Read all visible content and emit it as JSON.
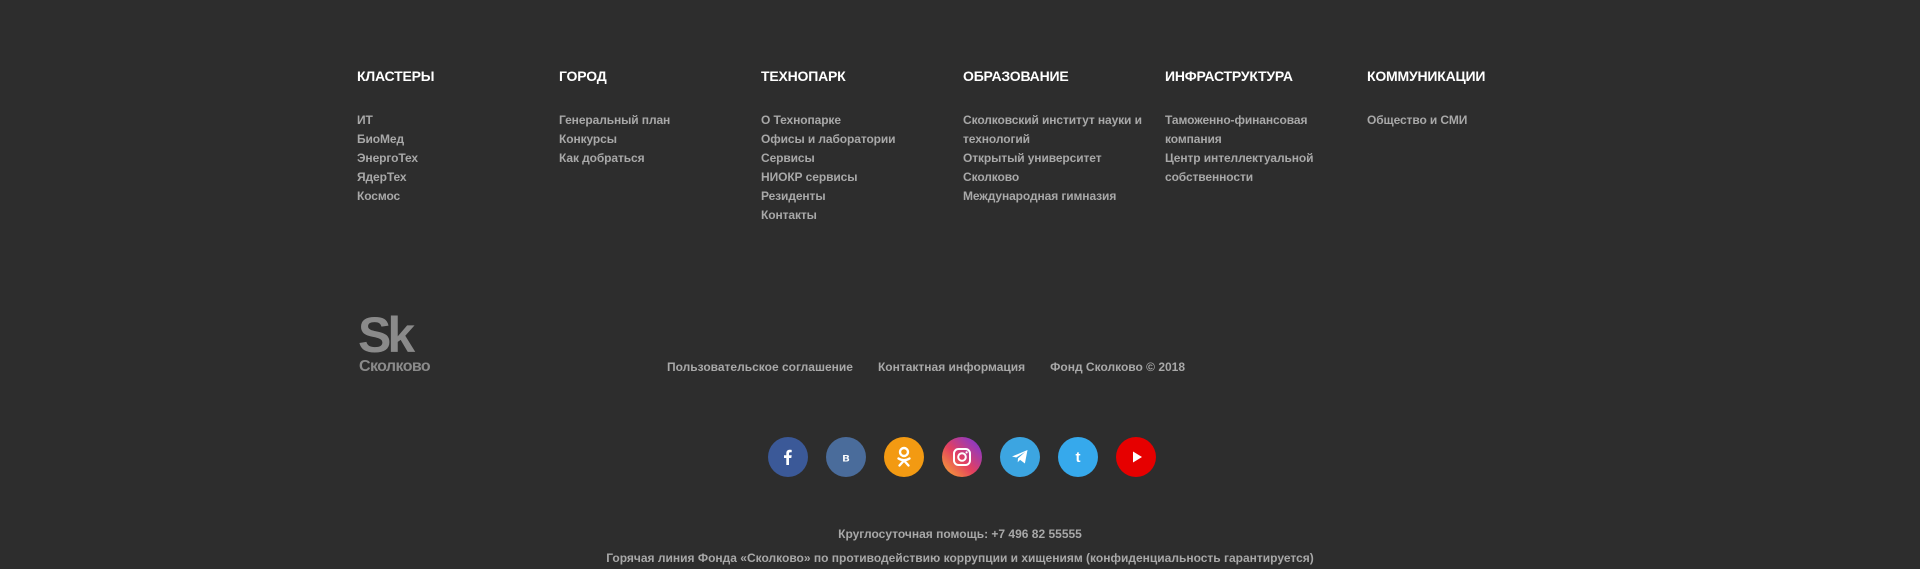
{
  "columns": [
    {
      "title": "КЛАСТЕРЫ",
      "items": [
        "ИТ",
        "БиоМед",
        "ЭнергоТех",
        "ЯдерТех",
        "Космос"
      ]
    },
    {
      "title": "ГОРОД",
      "items": [
        "Генеральный план",
        "Конкурсы",
        "Как добраться"
      ]
    },
    {
      "title": "ТЕХНОПАРК",
      "items": [
        "О Технопарке",
        "Офисы и лаборатории",
        "Сервисы",
        "НИОКР сервисы",
        "Резиденты",
        "Контакты"
      ]
    },
    {
      "title": "ОБРАЗОВАНИЕ",
      "items": [
        "Сколковский институт науки и технологий",
        "Открытый университет Сколково",
        "Международная гимназия"
      ]
    },
    {
      "title": "ИНФРАСТРУКТУРА",
      "items": [
        "Таможенно-финансовая компания",
        "Центр интеллектуальной собственности"
      ]
    },
    {
      "title": "КОММУНИКАЦИИ",
      "items": [
        "Общество и СМИ"
      ]
    }
  ],
  "logo": {
    "mark": "Sk",
    "wordmark": "Сколково",
    "icon": "skolkovo-logo"
  },
  "legal": {
    "agreement": "Пользовательское соглашение",
    "contacts": "Контактная информация",
    "copyright": "Фонд Сколково © 2018"
  },
  "social": [
    {
      "name": "facebook",
      "icon": "facebook-icon",
      "color": "#3b5998"
    },
    {
      "name": "vkontakte",
      "icon": "vk-icon",
      "color": "#4a6c9b"
    },
    {
      "name": "odnoklassniki",
      "icon": "ok-icon",
      "color": "#f39a12"
    },
    {
      "name": "instagram",
      "icon": "instagram-icon",
      "color": "#c13584"
    },
    {
      "name": "telegram",
      "icon": "telegram-icon",
      "color": "#3ca5e1"
    },
    {
      "name": "twitter",
      "icon": "twitter-icon",
      "color": "#36a9ec"
    },
    {
      "name": "youtube",
      "icon": "youtube-icon",
      "color": "#e60000"
    }
  ],
  "support": {
    "hotline24": "Круглосуточная помощь: +7 496 82 55555",
    "anticorruption": "Горячая линия Фонда «Сколково» по противодействию коррупции и хищениям (конфиденциальность гарантируется)"
  },
  "colors": {
    "background": "#2d2d2d",
    "heading": "#ffffff",
    "text": "#a8a8a8"
  }
}
